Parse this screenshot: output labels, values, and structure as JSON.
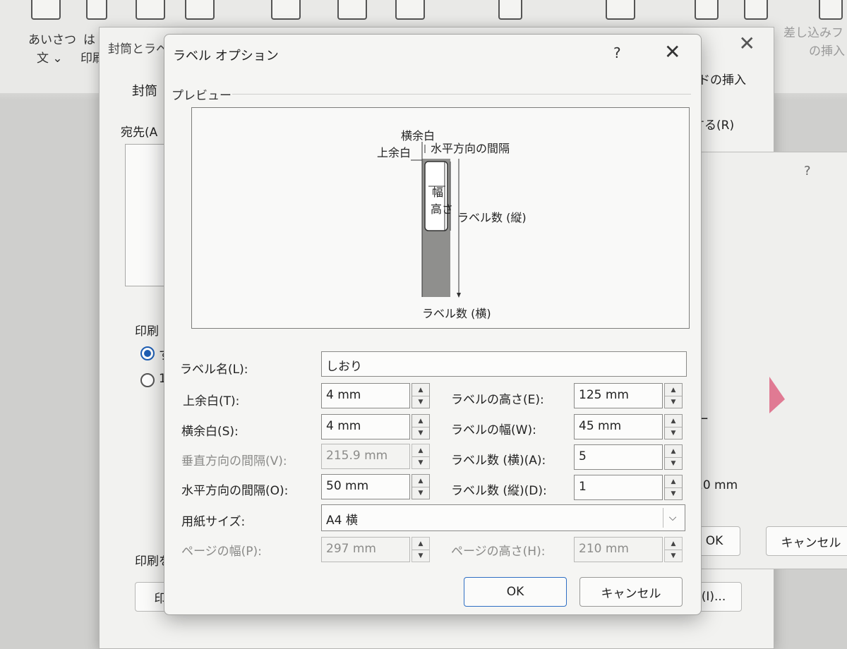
{
  "ribbon": {
    "items": [
      {
        "label": "あいさつ",
        "sub": "文 ⌄"
      },
      {
        "label": "は",
        "sub": "印刷"
      },
      {
        "label": "差し込みフ",
        "sub": "の挿入"
      }
    ]
  },
  "background_dialog": {
    "title": "封筒とラベル",
    "close": "✕",
    "tab_envelopes": "封筒",
    "address_label": "宛先(A",
    "print_group": "印刷",
    "radio1": "す",
    "radio2": "1",
    "print_note": "印刷を",
    "print_button": "印",
    "register_label": "する(R)",
    "insert_field_label": "ドの挿入",
    "options_button": "(I)...",
    "ok_button": "OK",
    "cancel_button": "キャンセル",
    "help": "?",
    "dash_label": "ー",
    "size_value": "10 mm"
  },
  "dialog": {
    "title": "ラベル オプション",
    "help": "?",
    "close": "✕",
    "preview_group": "プレビュー",
    "preview": {
      "side_margin": "横余白",
      "top_margin": "上余白",
      "horizontal_pitch": "水平方向の間隔",
      "width": "幅",
      "height": "高さ",
      "rows": "ラベル数 (縦)",
      "columns": "ラベル数 (横)"
    },
    "label_name": {
      "label": "ラベル名(L):",
      "value": "しおり"
    },
    "top_margin": {
      "label": "上余白(T):",
      "value": "4 mm"
    },
    "side_margin": {
      "label": "横余白(S):",
      "value": "4 mm"
    },
    "vertical_pitch": {
      "label": "垂直方向の間隔(V):",
      "value": "215.9 mm"
    },
    "horizontal_pitch": {
      "label": "水平方向の間隔(O):",
      "value": "50 mm"
    },
    "label_height": {
      "label": "ラベルの高さ(E):",
      "value": "125 mm"
    },
    "label_width": {
      "label": "ラベルの幅(W):",
      "value": "45 mm"
    },
    "number_across": {
      "label": "ラベル数 (横)(A):",
      "value": "5"
    },
    "number_down": {
      "label": "ラベル数 (縦)(D):",
      "value": "1"
    },
    "paper_size": {
      "label": "用紙サイズ:",
      "value": "A4 横"
    },
    "page_width": {
      "label": "ページの幅(P):",
      "value": "297 mm"
    },
    "page_height": {
      "label": "ページの高さ(H):",
      "value": "210 mm"
    },
    "ok": "OK",
    "cancel": "キャンセル"
  },
  "colors": {
    "accent": "#2f6fc4",
    "label_fill": "#8f8f8d"
  }
}
